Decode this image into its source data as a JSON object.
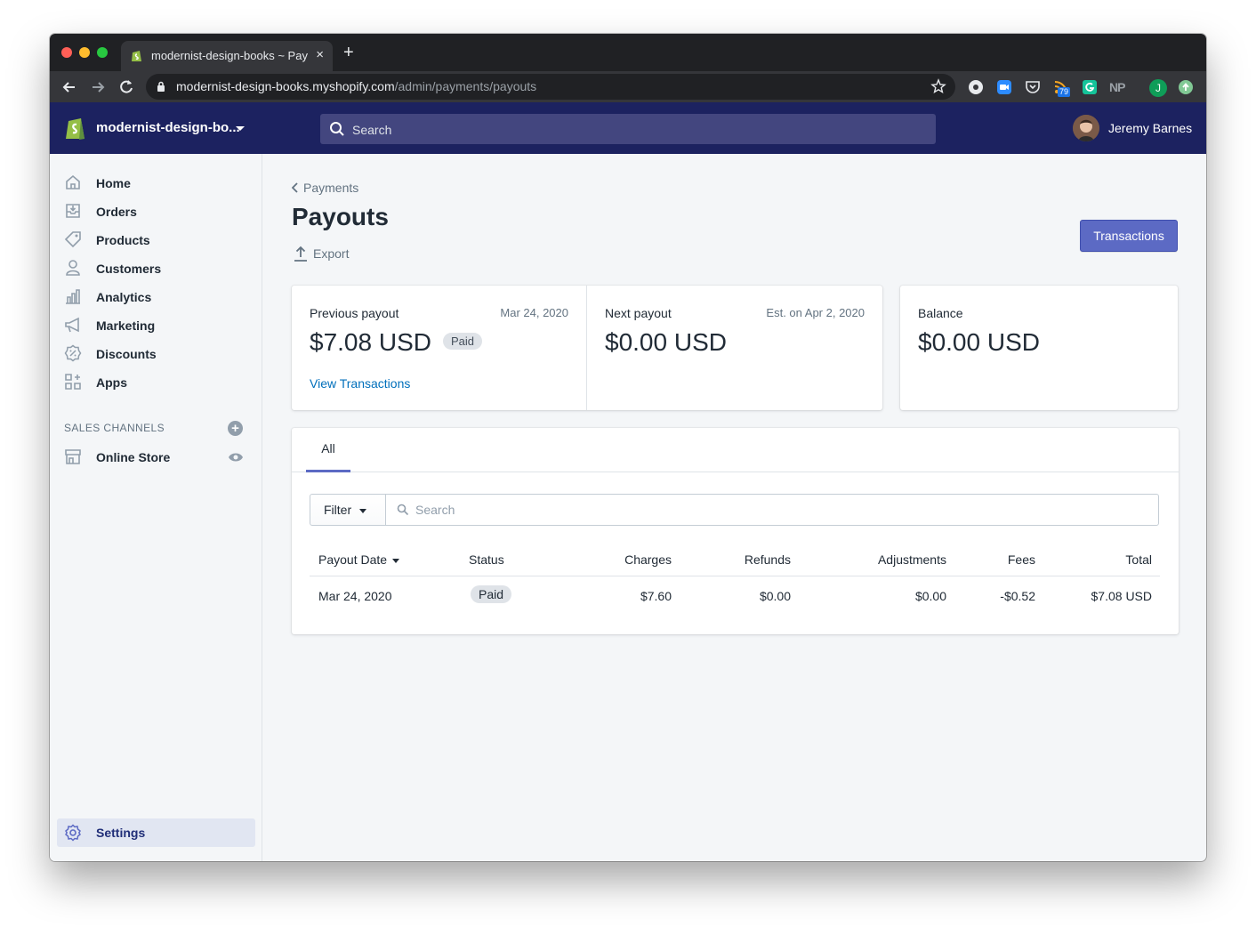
{
  "browser": {
    "tab_title": "modernist-design-books ~ Payouts",
    "new_tab_label": "+",
    "tab_close_label": "×",
    "url_host": "modernist-design-books.myshopify.com",
    "url_path": "/admin/payments/payouts",
    "extension_badge": "79",
    "extension_np": "NP",
    "profile_initial": "J"
  },
  "topbar": {
    "store_name": "modernist-design-bo...",
    "search_placeholder": "Search",
    "user_name": "Jeremy Barnes"
  },
  "sidebar": {
    "items": [
      {
        "label": "Home",
        "icon": "home-icon"
      },
      {
        "label": "Orders",
        "icon": "orders-icon"
      },
      {
        "label": "Products",
        "icon": "tag-icon"
      },
      {
        "label": "Customers",
        "icon": "person-icon"
      },
      {
        "label": "Analytics",
        "icon": "bar-chart-icon"
      },
      {
        "label": "Marketing",
        "icon": "megaphone-icon"
      },
      {
        "label": "Discounts",
        "icon": "discount-icon"
      },
      {
        "label": "Apps",
        "icon": "apps-icon"
      }
    ],
    "sales_channels_title": "SALES CHANNELS",
    "add_channel_label": "+",
    "online_store_label": "Online Store",
    "settings_label": "Settings"
  },
  "page": {
    "breadcrumb": "Payments",
    "title": "Payouts",
    "export_label": "Export",
    "transactions_button": "Transactions"
  },
  "summary": {
    "previous": {
      "label": "Previous payout",
      "date": "Mar 24, 2020",
      "amount": "$7.08 USD",
      "status": "Paid",
      "link": "View Transactions"
    },
    "next": {
      "label": "Next payout",
      "date": "Est. on Apr 2, 2020",
      "amount": "$0.00 USD"
    },
    "balance": {
      "label": "Balance",
      "amount": "$0.00 USD"
    }
  },
  "list": {
    "tab_all": "All",
    "filter_label": "Filter",
    "search_placeholder": "Search",
    "columns": [
      "Payout Date",
      "Status",
      "Charges",
      "Refunds",
      "Adjustments",
      "Fees",
      "Total"
    ],
    "rows": [
      {
        "date": "Mar 24, 2020",
        "status": "Paid",
        "charges": "$7.60",
        "refunds": "$0.00",
        "adjustments": "$0.00",
        "fees": "-$0.52",
        "total": "$7.08 USD"
      }
    ]
  },
  "colors": {
    "topbar": "#1c2260",
    "primary": "#5c6ac4",
    "link": "#006fbb"
  }
}
